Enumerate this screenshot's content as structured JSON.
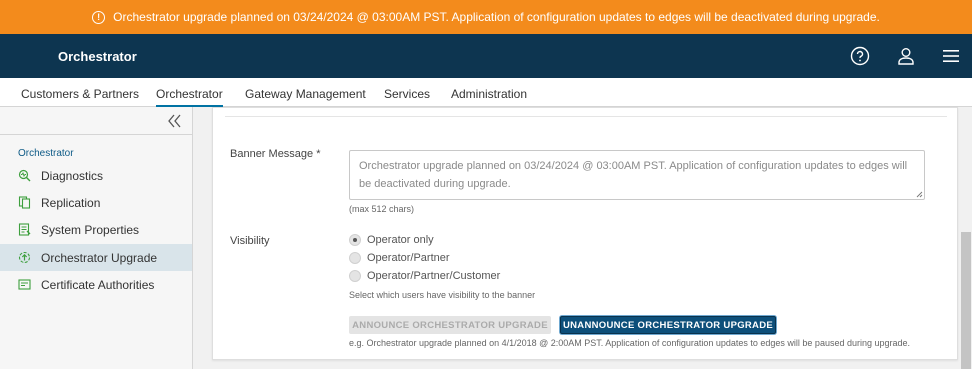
{
  "banner": {
    "message": "Orchestrator upgrade planned on 03/24/2024 @ 03:00AM PST. Application of configuration updates to edges will be deactivated during upgrade.",
    "icon": "info-icon",
    "color": "#f38b1c"
  },
  "header": {
    "title": "Orchestrator",
    "icons": [
      "help-icon",
      "user-icon",
      "menu-icon"
    ],
    "color": "#0d3550"
  },
  "nav": {
    "tabs": [
      {
        "label": "Customers & Partners"
      },
      {
        "label": "Orchestrator",
        "active": true
      },
      {
        "label": "Gateway Management"
      },
      {
        "label": "Services"
      },
      {
        "label": "Administration"
      }
    ]
  },
  "sidebar": {
    "heading": "Orchestrator",
    "items": [
      {
        "label": "Diagnostics",
        "icon": "diagnostics-icon"
      },
      {
        "label": "Replication",
        "icon": "replication-icon"
      },
      {
        "label": "System Properties",
        "icon": "system-properties-icon"
      },
      {
        "label": "Orchestrator Upgrade",
        "icon": "upgrade-icon",
        "active": true
      },
      {
        "label": "Certificate Authorities",
        "icon": "certificate-icon"
      }
    ]
  },
  "form": {
    "banner_label": "Banner Message",
    "required_mark": "*",
    "banner_value": "Orchestrator upgrade planned on 03/24/2024 @ 03:00AM PST. Application of configuration updates to edges will be deactivated during upgrade.",
    "char_limit_hint": "(max 512 chars)",
    "visibility_label": "Visibility",
    "visibility_options": [
      {
        "label": "Operator only",
        "selected": true
      },
      {
        "label": "Operator/Partner",
        "selected": false
      },
      {
        "label": "Operator/Partner/Customer",
        "selected": false
      }
    ],
    "visibility_hint": "Select which users have visibility to the banner",
    "announce_button": "ANNOUNCE ORCHESTRATOR UPGRADE",
    "unannounce_button": "UNANNOUNCE ORCHESTRATOR UPGRADE",
    "example_hint": "e.g. Orchestrator upgrade planned on 4/1/2018 @ 2:00AM PST. Application of configuration updates to edges will be paused during upgrade."
  }
}
